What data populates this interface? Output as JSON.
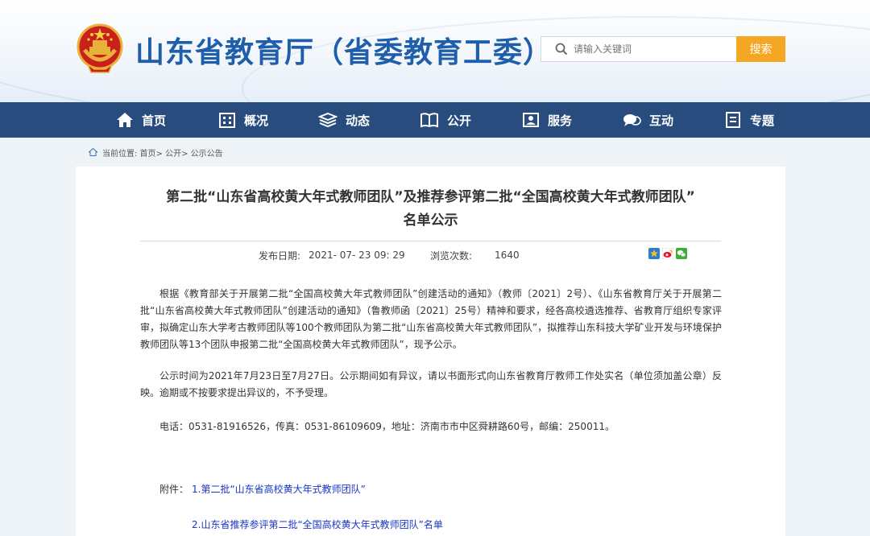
{
  "header": {
    "site_title": "山东省教育厅（省委教育工委）",
    "search_placeholder": "请输入关键词",
    "search_button": "搜索"
  },
  "nav": {
    "items": [
      {
        "label": "首页",
        "icon": "home-icon"
      },
      {
        "label": "概况",
        "icon": "building-icon"
      },
      {
        "label": "动态",
        "icon": "layers-icon"
      },
      {
        "label": "公开",
        "icon": "book-icon"
      },
      {
        "label": "服务",
        "icon": "service-icon"
      },
      {
        "label": "互动",
        "icon": "chat-icon"
      },
      {
        "label": "专题",
        "icon": "topic-icon"
      }
    ]
  },
  "breadcrumb": {
    "text": "当前位置: 首页> 公开> 公示公告"
  },
  "article": {
    "title_line1": "第二批“山东省高校黄大年式教师团队”及推荐参评第二批“全国高校黄大年式教师团队”",
    "title_line2": "名单公示",
    "publish_label": "发布日期:",
    "publish_date": "2021- 07- 23 09: 29",
    "views_label": "浏览次数:",
    "views": "1640",
    "paragraph1": "根据《教育部关于开展第二批“全国高校黄大年式教师团队”创建活动的通知》（教师〔2021〕2号）、《山东省教育厅关于开展第二批“山东省高校黄大年式教师团队”创建活动的通知》（鲁教师函〔2021〕25号）精神和要求，经各高校遴选推荐、省教育厅组织专家评审，拟确定山东大学考古教师团队等100个教师团队为第二批“山东省高校黄大年式教师团队”，拟推荐山东科技大学矿业开发与环境保护教师团队等13个团队申报第二批“全国高校黄大年式教师团队”，现予公示。",
    "paragraph2": "公示时间为2021年7月23日至7月27日。公示期间如有异议，请以书面形式向山东省教育厅教师工作处实名（单位须加盖公章）反映。逾期或不按要求提出异议的，不予受理。",
    "contact": "电话：0531-81916526，传真：0531-86109609，地址：济南市市中区舜耕路60号，邮编：250011。",
    "attachment_label": "附件：",
    "attachment1": "1.第二批“山东省高校黄大年式教师团队”",
    "attachment2": "2.山东省推荐参评第二批“全国高校黄大年式教师团队”名单"
  },
  "colors": {
    "brand_blue": "#1f5eab",
    "nav_bg": "#274c7d",
    "search_button": "#f5a623",
    "link": "#1a35c7"
  }
}
